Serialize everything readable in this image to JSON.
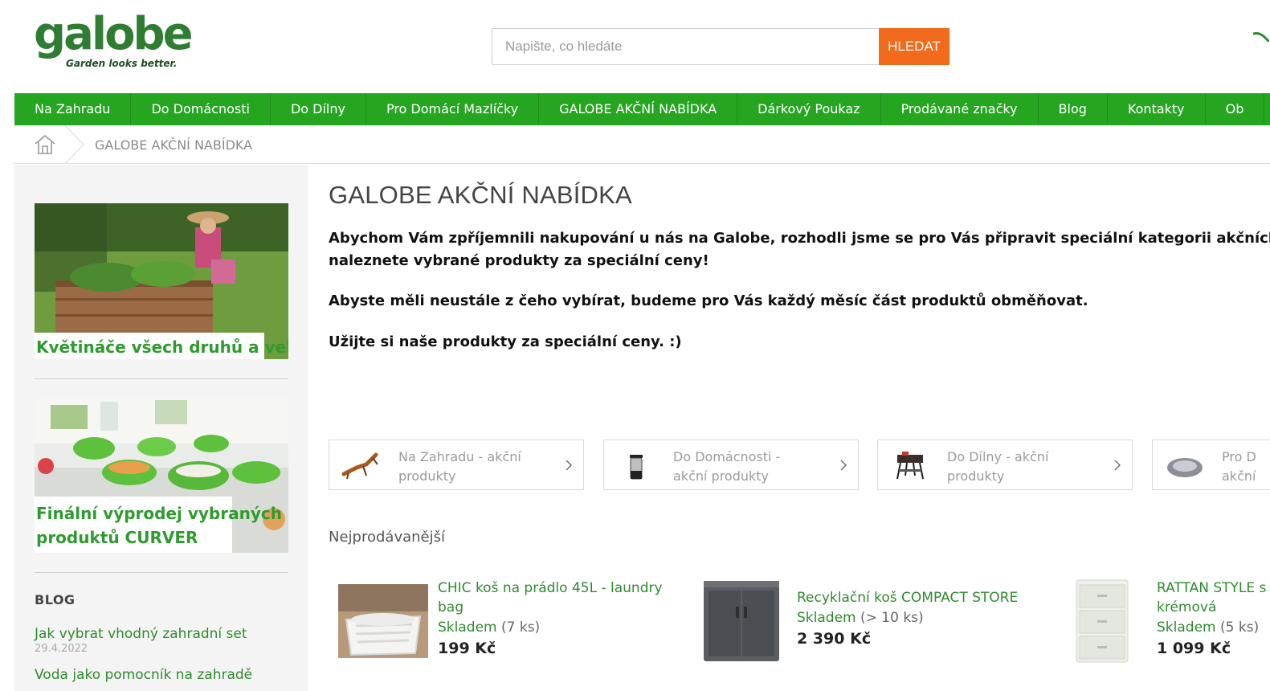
{
  "header": {
    "logo_text": "galobe",
    "logo_tagline": "Garden looks better.",
    "search": {
      "placeholder": "Napište, co hledáte",
      "button_label": "HLEDAT"
    }
  },
  "nav": {
    "items": [
      {
        "label": "Na Zahradu"
      },
      {
        "label": "Do Domácnosti"
      },
      {
        "label": "Do Dílny"
      },
      {
        "label": "Pro Domácí Mazlíčky"
      },
      {
        "label": "GALOBE AKČNÍ NABÍDKA"
      },
      {
        "label": "Dárkový Poukaz"
      },
      {
        "label": "Prodávané značky"
      },
      {
        "label": "Blog"
      },
      {
        "label": "Kontakty"
      },
      {
        "label": "Ob"
      }
    ]
  },
  "breadcrumb": {
    "current": "GALOBE AKČNÍ NABÍDKA"
  },
  "sidebar": {
    "banners": [
      {
        "caption": "Květináče všech druhů a velikostí"
      },
      {
        "caption_line1": "Finální výprodej vybraných",
        "caption_line2": "produktů CURVER"
      }
    ],
    "blog": {
      "title": "BLOG",
      "posts": [
        {
          "title": "Jak vybrat vhodný zahradní set",
          "date": "29.4.2022"
        },
        {
          "title": "Voda jako pomocník na zahradě"
        }
      ]
    }
  },
  "main": {
    "title": "GALOBE AKČNÍ NABÍDKA",
    "paragraphs": [
      "Abychom Vám zpříjemnili nakupování u nás na Galobe, rozhodli jsme se pro Vás připravit speciální kategorii akčních produ",
      "naleznete vybrané produkty za speciální ceny!",
      "Abyste měli neustále z čeho vybírat, budeme pro Vás každý měsíc část produktů obměňovat.",
      "Užijte si naše produkty za speciální ceny. :)"
    ],
    "categories": [
      {
        "line1": "Na Zahradu - akční",
        "line2": "produkty",
        "icon": "sun-lounger-icon"
      },
      {
        "line1": "Do Domácnosti -",
        "line2": "akční produkty",
        "icon": "trash-bin-icon"
      },
      {
        "line1": "Do Dílny - akční",
        "line2": "produkty",
        "icon": "workbench-icon"
      },
      {
        "line1": "Pro D",
        "line2": "akční",
        "icon": "pet-bed-icon"
      }
    ],
    "bestsellers": {
      "heading": "Nejprodávanější",
      "products": [
        {
          "name_line1": "CHIC koš na prádlo 45L - laundry",
          "name_line2": "bag",
          "stock": "Skladem",
          "qty": "(7 ks)",
          "price": "199 Kč"
        },
        {
          "name_line1": "Recyklační koš COMPACT STORE",
          "stock": "Skladem",
          "qty": "(> 10 ks)",
          "price": "2 390 Kč"
        },
        {
          "name_line1": "RATTAN STYLE s",
          "name_line2": "krémová",
          "stock": "Skladem",
          "qty": "(5 ks)",
          "price": "1 099 Kč"
        }
      ]
    }
  },
  "colors": {
    "brand_green": "#26a521",
    "link_green": "#2e8b2e",
    "search_button": "#f26a1b",
    "logo_green": "#2f7d32"
  }
}
